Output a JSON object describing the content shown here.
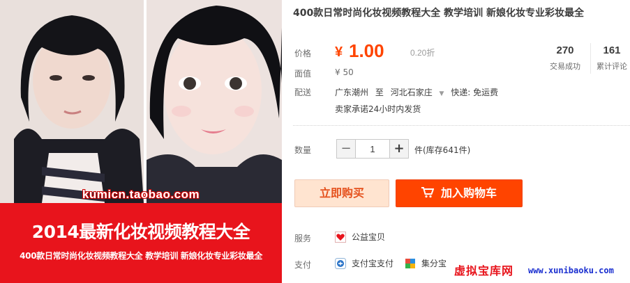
{
  "image": {
    "watermark_url": "kumicn.taobao.com",
    "banner_main": "2014最新化妆视频教程大全",
    "banner_sub": "400款日常时尚化妆视频教程大全 教学培训 新娘化妆专业彩妆最全"
  },
  "product": {
    "title": "400款日常时尚化妆视频教程大全 教学培训 新娘化妆专业彩妆最全",
    "price_label": "价格",
    "price_symbol": "¥",
    "price": "1.00",
    "discount": "0.20折",
    "sales_count": "270",
    "sales_label": "交易成功",
    "reviews_count": "161",
    "reviews_label": "累计评论",
    "original_label": "面值",
    "original_price": "¥ 50",
    "shipping_label": "配送",
    "ship_from": "广东潮州",
    "ship_to_word": "至",
    "ship_to": "河北石家庄",
    "ship_fee": "快递: 免运费",
    "promise": "卖家承诺24小时内发货",
    "quantity_label": "数量",
    "quantity": "1",
    "stock": "件(库存641件)",
    "buy_now": "立即购买",
    "add_to_cart": "加入购物车",
    "service_label": "服务",
    "service_item": "公益宝贝",
    "payment_label": "支付",
    "payment_methods": [
      "支付宝支付",
      "集分宝"
    ]
  },
  "footer_watermark": {
    "site_cn": "虚拟宝库网",
    "site_url": "www.xunibaoku.com"
  },
  "colors": {
    "price": "#ff4400",
    "banner": "#e8141c",
    "cart_button": "#ff4400",
    "buy_button_bg": "#ffe4d0"
  }
}
